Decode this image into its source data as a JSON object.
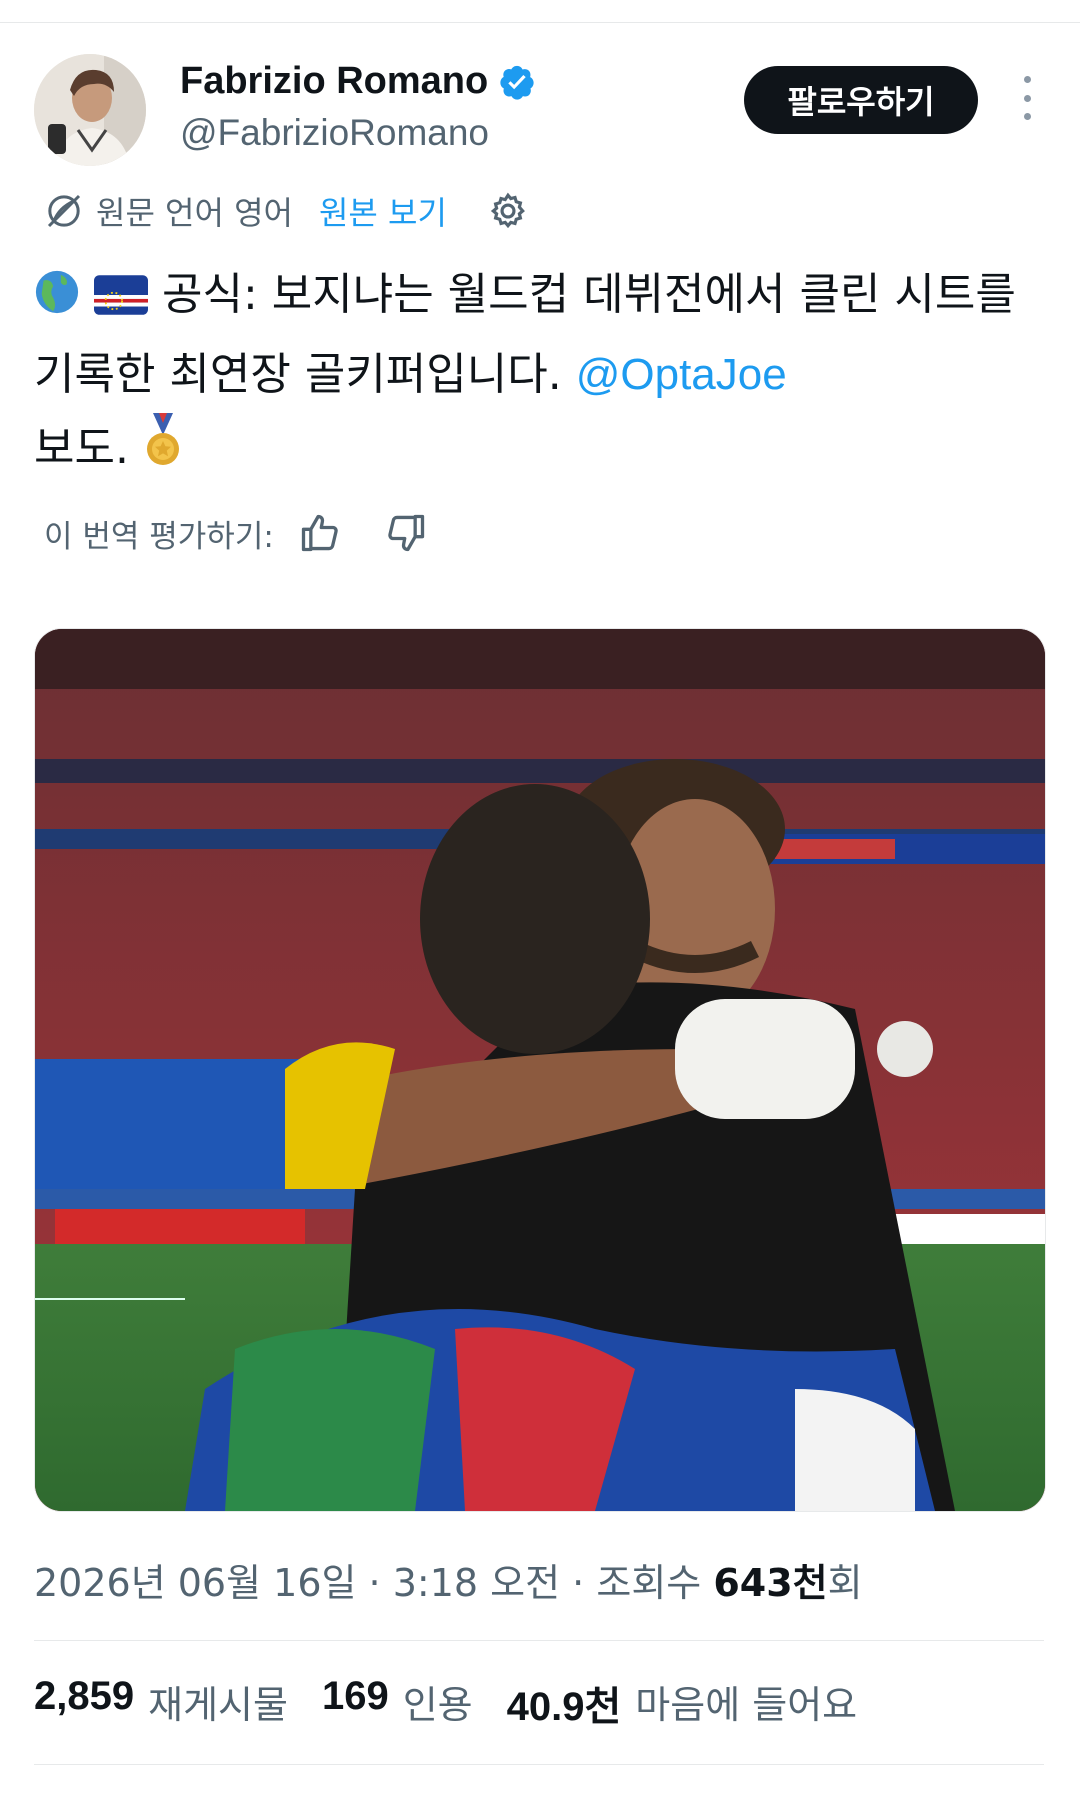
{
  "author": {
    "name": "Fabrizio Romano",
    "handle": "@FabrizioRomano",
    "verified": true,
    "verified_color": "#1d9bf0"
  },
  "follow_button": {
    "label": "팔로우하기"
  },
  "more_button": {
    "icon": "more-vertical-icon"
  },
  "translation": {
    "icon": "translate-icon",
    "source_language": "원문 언어 영어",
    "show_original": "원본 보기",
    "settings_icon": "gear-icon"
  },
  "tweet": {
    "emoji_prefix": "🌎🇨🇻",
    "text": "공식: 보지냐는 월드컵 데뷔전에서 클린 시트를 기록한 최연장 골키퍼입니다.",
    "mention": "@OptaJoe",
    "suffix": "보도.",
    "emoji_suffix": "🏅"
  },
  "rating": {
    "label": "이 번역 평가하기:",
    "thumbs_up_icon": "thumbs-up-icon",
    "thumbs_down_icon": "thumbs-down-icon"
  },
  "media": {
    "description_icon": "photo"
  },
  "meta": {
    "date": "2026년 06월 16일",
    "separator": "·",
    "time": "3:18 오전",
    "views_label": "조회수",
    "views_value": "643천",
    "views_suffix": "회"
  },
  "stats": {
    "retweets_value": "2,859",
    "retweets_label": "재게시물",
    "quotes_value": "169",
    "quotes_label": "인용",
    "likes_value": "40.9천",
    "likes_label": "마음에 들어요"
  },
  "colors": {
    "link": "#1d9bf0",
    "text_primary": "#0f1419",
    "text_secondary": "#536471",
    "button_bg": "#0f1419"
  }
}
